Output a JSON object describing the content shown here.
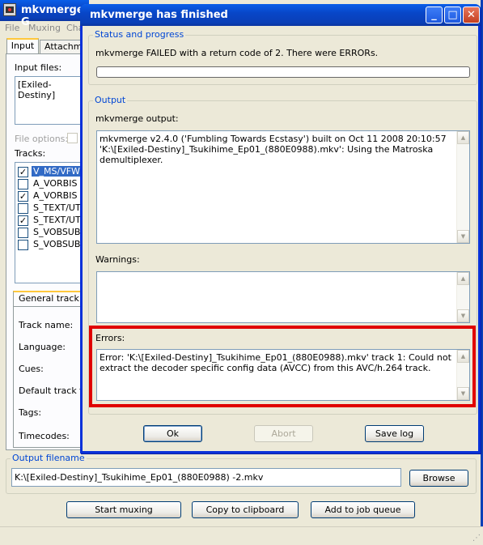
{
  "main_window": {
    "title": "mkvmerge G",
    "menu": [
      "File",
      "Muxing",
      "Cha"
    ],
    "tabs": [
      "Input",
      "Attachme"
    ],
    "input_files_label": "Input files:",
    "input_file_item": "[Exiled-Destiny]",
    "file_options_label": "File options:",
    "tracks_label": "Tracks:",
    "tracks": [
      {
        "label": "V_MS/VFW/F",
        "checked": true,
        "selected": true
      },
      {
        "label": "A_VORBIS (I",
        "checked": false,
        "selected": false
      },
      {
        "label": "A_VORBIS (I",
        "checked": true,
        "selected": false
      },
      {
        "label": "S_TEXT/UTF",
        "checked": false,
        "selected": false
      },
      {
        "label": "S_TEXT/UTF",
        "checked": true,
        "selected": false
      },
      {
        "label": "S_VOBSUB (I",
        "checked": false,
        "selected": false
      },
      {
        "label": "S_VOBSUB (I",
        "checked": false,
        "selected": false
      }
    ],
    "general_track_tab": "General track op",
    "track_fields": [
      "Track name:",
      "Language:",
      "Cues:",
      "Default track fla",
      "Tags:",
      "Timecodes:"
    ],
    "output_group_label": "Output filename",
    "output_filename": "K:\\[Exiled-Destiny]_Tsukihime_Ep01_(880E0988) -2.mkv",
    "browse_label": "Browse",
    "start_muxing_label": "Start muxing",
    "copy_clipboard_label": "Copy to clipboard",
    "add_job_label": "Add to job queue"
  },
  "dialog": {
    "title": "mkvmerge has finished",
    "status_group": "Status and progress",
    "status_text": "mkvmerge FAILED with a return code of 2. There were ERRORs.",
    "progress": 0,
    "output_group": "Output",
    "output_label": "mkvmerge output:",
    "output_text": "mkvmerge v2.4.0 ('Fumbling Towards Ecstasy') built on Oct 11 2008 20:10:57\n'K:\\[Exiled-Destiny]_Tsukihime_Ep01_(880E0988).mkv': Using the Matroska demultiplexer.",
    "warnings_label": "Warnings:",
    "warnings_text": "",
    "errors_label": "Errors:",
    "errors_text": "Error: 'K:\\[Exiled-Destiny]_Tsukihime_Ep01_(880E0988).mkv' track 1: Could not extract the decoder specific config data (AVCC) from this AVC/h.264 track.",
    "ok_label": "Ok",
    "abort_label": "Abort",
    "save_log_label": "Save log",
    "highlight_color": "#e00000"
  }
}
